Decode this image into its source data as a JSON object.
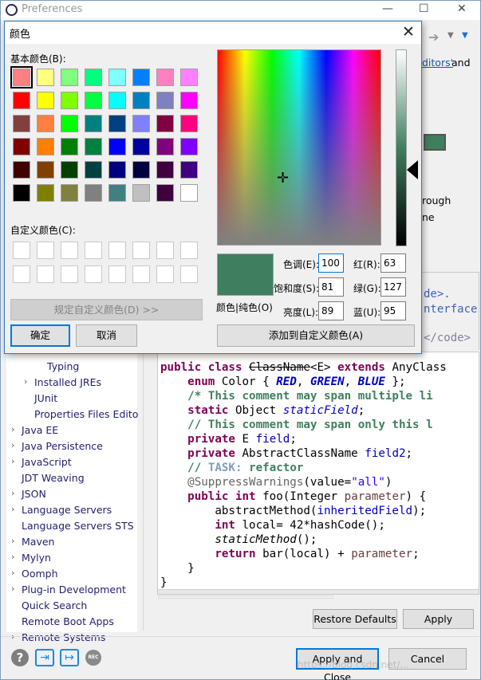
{
  "prefs": {
    "title": "Preferences",
    "bg_text": {
      "editors_link": "ditors'",
      "and": "and",
      "rough": "rough",
      "ne": "ne",
      "de": "de>.",
      "interface": "nterface",
      "code_end": "</code>"
    },
    "tree": [
      {
        "label": "Typing",
        "indent": 2,
        "arrow": false
      },
      {
        "label": "Installed JREs",
        "indent": 1,
        "arrow": true
      },
      {
        "label": "JUnit",
        "indent": 1,
        "arrow": false
      },
      {
        "label": "Properties Files Edito",
        "indent": 1,
        "arrow": false
      },
      {
        "label": "Java EE",
        "indent": 0,
        "arrow": true
      },
      {
        "label": "Java Persistence",
        "indent": 0,
        "arrow": true
      },
      {
        "label": "JavaScript",
        "indent": 0,
        "arrow": true
      },
      {
        "label": "JDT Weaving",
        "indent": 0,
        "arrow": false
      },
      {
        "label": "JSON",
        "indent": 0,
        "arrow": true
      },
      {
        "label": "Language Servers",
        "indent": 0,
        "arrow": true
      },
      {
        "label": "Language Servers STS",
        "indent": 0,
        "arrow": false
      },
      {
        "label": "Maven",
        "indent": 0,
        "arrow": true
      },
      {
        "label": "Mylyn",
        "indent": 0,
        "arrow": true
      },
      {
        "label": "Oomph",
        "indent": 0,
        "arrow": true
      },
      {
        "label": "Plug-in Development",
        "indent": 0,
        "arrow": true
      },
      {
        "label": "Quick Search",
        "indent": 0,
        "arrow": false
      },
      {
        "label": "Remote Boot Apps",
        "indent": 0,
        "arrow": false
      },
      {
        "label": "Remote Systems",
        "indent": 0,
        "arrow": true
      }
    ],
    "restore_defaults": "Restore Defaults",
    "apply": "Apply",
    "apply_and_close": "Apply and Close",
    "cancel": "Cancel",
    "watermark": "https://blog.csdn.net/..."
  },
  "code": {
    "l1_kw1": "public",
    "l1_kw2": "class",
    "l1_name": "ClassName",
    "l1_gen": "<E>",
    "l1_kw3": "extends",
    "l1_rest": "AnyClass",
    "l2_kw": "enum",
    "l2_name": "Color {",
    "l2_c1": "RED",
    "l2_c2": "GREEN",
    "l2_c3": "BLUE",
    "l2_end": "};",
    "l3": "/* This comment may span multiple li",
    "l4_kw": "static",
    "l4_type": "Object",
    "l4_field": "staticField",
    "l5": "// This comment may span only this l",
    "l6_kw": "private",
    "l6_type": "E",
    "l6_field": "field",
    "l7_kw": "private",
    "l7_type": "AbstractClassName",
    "l7_field": "field2",
    "l8_slash": "//",
    "l8_task": "TASK:",
    "l8_rest": "refactor",
    "l9_an": "@SuppressWarnings",
    "l9_open": "(value=",
    "l9_str": "\"all\"",
    "l9_close": ")",
    "l10_kw1": "public",
    "l10_kw2": "int",
    "l10_name": "foo(Integer",
    "l10_param": "parameter",
    "l10_end": ") {",
    "l11_m": "abstractMethod(",
    "l11_f": "inheritedField",
    "l11_end": ");",
    "l12_kw": "int",
    "l12_rest": "local= 42*hashCode();",
    "l13_m": "staticMethod",
    "l13_end": "();",
    "l14_kw": "return",
    "l14_rest": "bar(local) +",
    "l14_param": "parameter",
    "l14_end": ";",
    "l15": "}",
    "l16": "}"
  },
  "dialog": {
    "title": "颜色",
    "basic_colors_label": "基本颜色(B):",
    "custom_colors_label": "自定义颜色(C):",
    "define_custom": "规定自定义颜色(D) >>",
    "ok": "确定",
    "cancel": "取消",
    "add_custom": "添加到自定义颜色(A)",
    "solid_label": "颜色|纯色(O)",
    "hue_label": "色调(E):",
    "hue": "100",
    "sat_label": "饱和度(S):",
    "sat": "81",
    "lum_label": "亮度(L):",
    "lum": "89",
    "red_label": "红(R):",
    "red": "63",
    "green_label": "绿(G):",
    "green": "127",
    "blue_label": "蓝(U):",
    "blue": "95",
    "current_color": "#3f7f5f",
    "basic_colors": [
      "#ff8080",
      "#ffff80",
      "#80ff80",
      "#00ff80",
      "#80ffff",
      "#0080ff",
      "#ff80c0",
      "#ff80ff",
      "#ff0000",
      "#ffff00",
      "#80ff00",
      "#00ff40",
      "#00ffff",
      "#0080c0",
      "#8080c0",
      "#ff00ff",
      "#804040",
      "#ff8040",
      "#00ff00",
      "#008080",
      "#004080",
      "#8080ff",
      "#800040",
      "#ff0080",
      "#800000",
      "#ff8000",
      "#008000",
      "#008040",
      "#0000ff",
      "#0000a0",
      "#800080",
      "#8000ff",
      "#400000",
      "#804000",
      "#004000",
      "#004040",
      "#000080",
      "#000040",
      "#400040",
      "#400080",
      "#000000",
      "#808000",
      "#808040",
      "#808080",
      "#408080",
      "#c0c0c0",
      "#400040",
      "#ffffff"
    ]
  }
}
